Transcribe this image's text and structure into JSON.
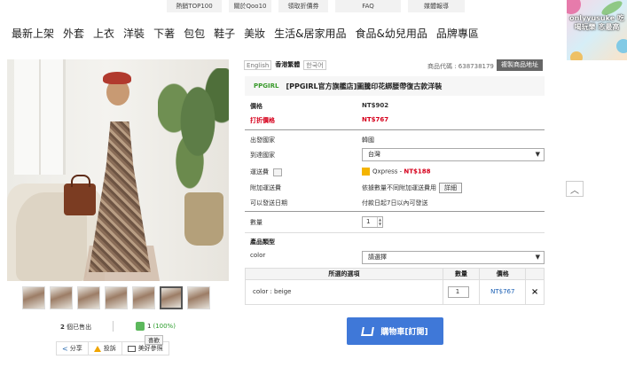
{
  "top_links": [
    "熱銷TOP100",
    "關於Qoo10",
    "領取折價券",
    "FAQ",
    "媒體報導"
  ],
  "main_nav": [
    "最新上架",
    "外套",
    "上衣",
    "洋裝",
    "下著",
    "包包",
    "鞋子",
    "美妝",
    "生活&居家用品",
    "食品&幼兒用品",
    "品牌專區"
  ],
  "promo": {
    "text": "onlyyusuke 吃喝玩樂 忞最高"
  },
  "languages": {
    "en": "English",
    "zh": "香港繁體",
    "ko": "한국어"
  },
  "product": {
    "code_label": "商品代碼 : 638738179",
    "copy_button": "複製商品地址",
    "brand": "PPGIRL",
    "title": "[PPGIRL官方旗艦店]圖騰印花綁腰帶復古款洋裝",
    "price_label": "價格",
    "price": "NT$902",
    "sale_label": "打折價格",
    "sale_price": "NT$767",
    "origin_label": "出發國家",
    "origin": "韓國",
    "dest_label": "到達國家",
    "dest": "台灣",
    "ship_label": "運送費",
    "ship_method": "Qxpress -",
    "ship_price": "NT$188",
    "extra_label": "附加運送費",
    "extra_text": "依據數量不同附加運送費用",
    "detail_button": "詳細",
    "ship_date_label": "可以發送日期",
    "ship_date": "付款日起7日以內可發送",
    "qty_label": "數量",
    "qty": "1",
    "type_label": "產品類型",
    "color_label": "color",
    "color_placeholder": "請選擇"
  },
  "options_table": {
    "headers": [
      "所選的選項",
      "數量",
      "價格"
    ],
    "rows": [
      {
        "option": "color : beige",
        "qty": "1",
        "price": "NT$767",
        "remove": "×"
      }
    ]
  },
  "cart_button": "購物車[訂閱]",
  "stats": {
    "sold_count": "2",
    "sold_text": "個已售出",
    "likes": "1",
    "likes_pct": "(100%)",
    "tooltip": "喜歡"
  },
  "actions": [
    "分享",
    "投訴",
    "美好參照"
  ],
  "icons": {
    "back_to_top": "chevron-up-icon",
    "cart": "cart-icon"
  },
  "colors": {
    "sale_red": "#d6001c",
    "brand_green": "#3a9a2c",
    "cart_blue": "#3f78d8"
  }
}
